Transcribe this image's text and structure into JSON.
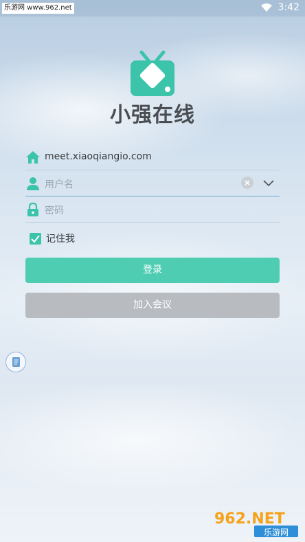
{
  "statusbar": {
    "watermark": "乐游网 www.962.net",
    "time": "3:42"
  },
  "app": {
    "name": "小强在线"
  },
  "form": {
    "server": {
      "value": "meet.xiaoqiangio.com"
    },
    "username": {
      "placeholder": "用户名"
    },
    "password": {
      "placeholder": "密码"
    },
    "remember": {
      "label": "记住我",
      "checked": true
    }
  },
  "buttons": {
    "login": "登录",
    "join": "加入会议"
  },
  "watermark_bottom": {
    "brand": "962.NET",
    "sub": "乐游网"
  },
  "colors": {
    "accent": "#4ecdb2",
    "disabled": "#b8bcc0",
    "logo": "#3cc4aa"
  }
}
